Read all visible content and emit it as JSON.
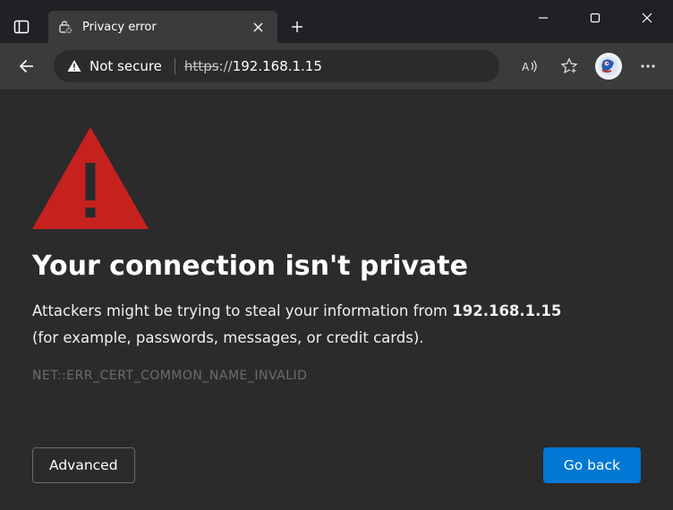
{
  "window": {
    "minimize": "—",
    "maximize": "▢",
    "close": "✕"
  },
  "tab": {
    "title": "Privacy error",
    "close": "✕",
    "new_tab": "+"
  },
  "toolbar": {
    "not_secure_label": "Not secure",
    "url_protocol": "https",
    "url_sep": "://",
    "url_host": "192.168.1.15"
  },
  "page": {
    "heading": "Your connection isn't private",
    "body_prefix": "Attackers might be trying to steal your information from ",
    "body_ip": "192.168.1.15",
    "body_suffix": "(for example, passwords, messages, or credit cards).",
    "error_code": "NET::ERR_CERT_COMMON_NAME_INVALID",
    "advanced_label": "Advanced",
    "go_back_label": "Go back"
  }
}
